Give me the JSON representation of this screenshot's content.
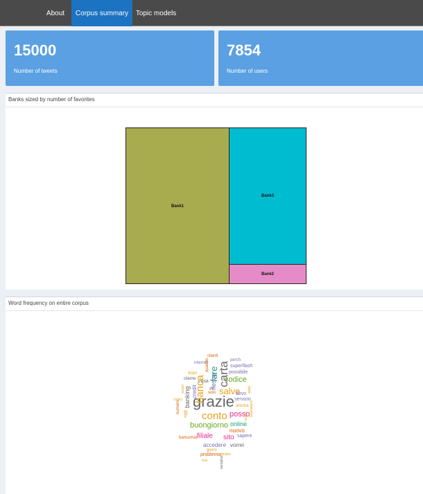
{
  "nav": {
    "tabs": [
      {
        "label": "About",
        "active": false
      },
      {
        "label": "Corpus summary",
        "active": true
      },
      {
        "label": "Topic models",
        "active": false
      }
    ]
  },
  "valueboxes": [
    {
      "value": "15000",
      "label": "Number of tweets"
    },
    {
      "value": "7854",
      "label": "Number of users"
    }
  ],
  "treemap_panel": {
    "title": "Banks sized by number of favorites"
  },
  "chart_data": {
    "type": "treemap",
    "items": [
      {
        "label": "Bank1",
        "color": "#a9ab4f"
      },
      {
        "label": "Bank3",
        "color": "#00bcd1"
      },
      {
        "label": "Bank2",
        "color": "#e58bc8"
      }
    ]
  },
  "wordcloud_panel": {
    "title": "Word frequency on entire corpus"
  },
  "wordcloud": {
    "words": [
      {
        "text": "grazie",
        "color": "#666666"
      },
      {
        "text": "carta",
        "color": "#666666"
      },
      {
        "text": "banca",
        "color": "#e5a21a"
      },
      {
        "text": "conto",
        "color": "#e5a21a"
      },
      {
        "text": "fare",
        "color": "#1b9e77"
      },
      {
        "text": "salve",
        "color": "#e5a21a"
      },
      {
        "text": "codice",
        "color": "#66a61e"
      },
      {
        "text": "buongiorno",
        "color": "#66a61e"
      },
      {
        "text": "posso",
        "color": "#e7298a"
      },
      {
        "text": "filiale",
        "color": "#e7298a"
      },
      {
        "text": "sito",
        "color": "#e7298a"
      },
      {
        "text": "online",
        "color": "#1b9e77"
      },
      {
        "text": "nuovo",
        "color": "#d95f02"
      },
      {
        "text": "accedere",
        "color": "#7570b3"
      },
      {
        "text": "vorrei",
        "color": "#666666"
      },
      {
        "text": "sapere",
        "color": "#7570b3"
      },
      {
        "text": "servizio",
        "color": "#7570b3"
      },
      {
        "text": "devo",
        "color": "#7570b3"
      },
      {
        "text": "ancora",
        "color": "#e5a21a"
      },
      {
        "text": "possibile",
        "color": "#7570b3"
      },
      {
        "text": "superflash",
        "color": "#7570b3"
      },
      {
        "text": "perch",
        "color": "#7570b3"
      },
      {
        "text": "clienti",
        "color": "#d95f02"
      },
      {
        "text": "internet",
        "color": "#7570b3"
      },
      {
        "text": "riesco",
        "color": "#7570b3"
      },
      {
        "text": "credit",
        "color": "#7570b3"
      },
      {
        "text": "banking",
        "color": "#666666"
      },
      {
        "text": "cosa",
        "color": "#666666"
      },
      {
        "text": "dopo",
        "color": "#e5a21a"
      },
      {
        "text": "cliente",
        "color": "#666666"
      },
      {
        "text": "quando",
        "color": "#d95f02"
      },
      {
        "text": "solo",
        "color": "#d95f02"
      },
      {
        "text": "girl",
        "color": "#666666"
      },
      {
        "text": "oggi",
        "color": "#e5a21a"
      },
      {
        "text": "numero",
        "color": "#d95f02"
      },
      {
        "text": "scopri",
        "color": "#e5a21a"
      },
      {
        "text": "codici",
        "color": "#e5a21a"
      },
      {
        "text": "bancomat",
        "color": "#d95f02"
      },
      {
        "text": "giorni",
        "color": "#e5a21a"
      },
      {
        "text": "problema",
        "color": "#d95f02"
      },
      {
        "text": "titolare",
        "color": "#e5a21a"
      },
      {
        "text": "mai",
        "color": "#e5a21a"
      },
      {
        "text": "semplice",
        "color": "#666666"
      },
      {
        "text": "nuova",
        "color": "#e5a21a"
      },
      {
        "text": "buonasera",
        "color": "#e5a21a"
      },
      {
        "text": "stato",
        "color": "#e5a21a"
      }
    ]
  }
}
